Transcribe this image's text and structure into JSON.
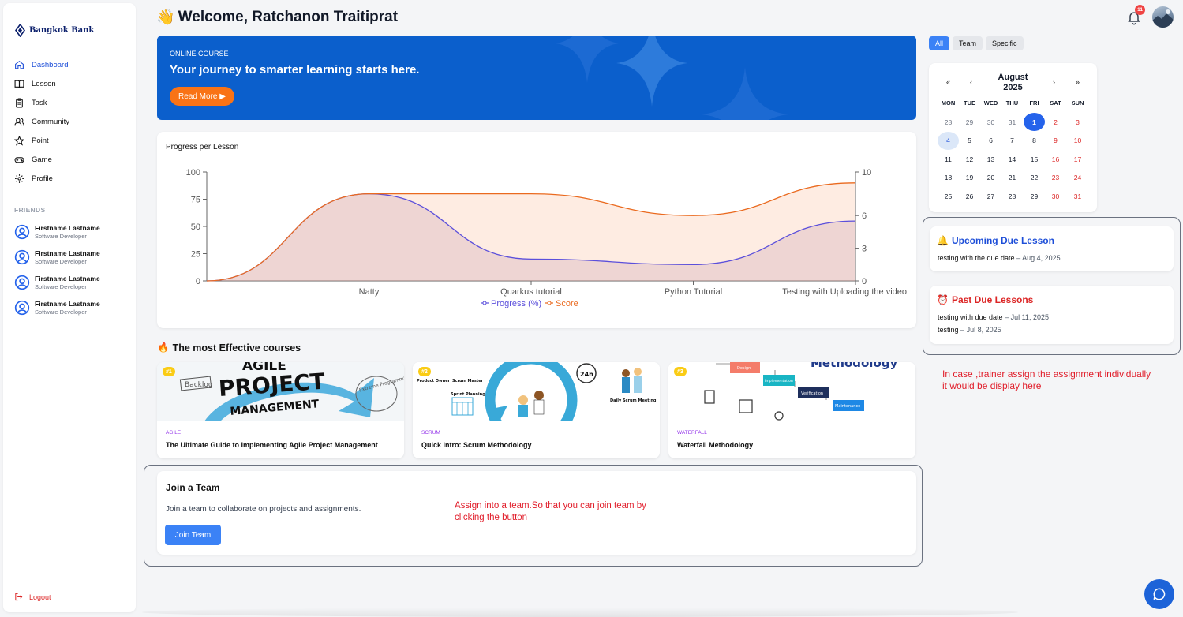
{
  "brand": {
    "name": "Bangkok Bank"
  },
  "sidebar": {
    "items": [
      {
        "label": "Dashboard",
        "icon": "home-icon",
        "active": true
      },
      {
        "label": "Lesson",
        "icon": "book-icon"
      },
      {
        "label": "Task",
        "icon": "clipboard-icon"
      },
      {
        "label": "Community",
        "icon": "users-icon"
      },
      {
        "label": "Point",
        "icon": "star-icon"
      },
      {
        "label": "Game",
        "icon": "gamepad-icon"
      },
      {
        "label": "Profile",
        "icon": "gear-icon"
      }
    ],
    "friends_heading": "FRIENDS",
    "friends": [
      {
        "name": "Firstname Lastname",
        "role": "Software Developer"
      },
      {
        "name": "Firstname Lastname",
        "role": "Software Developer"
      },
      {
        "name": "Firstname Lastname",
        "role": "Software Developer"
      },
      {
        "name": "Firstname Lastname",
        "role": "Software Developer"
      }
    ],
    "logout": "Logout"
  },
  "header": {
    "wave": "👋",
    "welcome": "Welcome, Ratchanon Traitiprat",
    "notification_count": "11"
  },
  "banner": {
    "kicker": "ONLINE COURSE",
    "title": "Your journey to smarter learning starts here.",
    "button": "Read More ▶"
  },
  "progress_card": {
    "title": "Progress per Lesson"
  },
  "chart_data": {
    "type": "area",
    "title": "Progress per Lesson",
    "categories": [
      "",
      "Natty",
      "Quarkus tutorial",
      "Python Tutorial",
      "Testing with Uploading the video"
    ],
    "series": [
      {
        "name": "Progress (%)",
        "axis": "left",
        "color": "#5b4fdb",
        "values": [
          0,
          80,
          20,
          15,
          55
        ]
      },
      {
        "name": "Score",
        "axis": "right",
        "color": "#ea6a1f",
        "values": [
          0,
          8,
          8,
          6,
          9
        ]
      }
    ],
    "y_left": {
      "ticks": [
        0,
        25,
        50,
        75,
        100
      ],
      "range": [
        0,
        100
      ]
    },
    "y_right": {
      "ticks": [
        0,
        3,
        6,
        10
      ],
      "range": [
        0,
        10
      ]
    },
    "legend_position": "bottom-center"
  },
  "courses": {
    "heading_icon": "🔥",
    "heading": "The most Effective courses",
    "items": [
      {
        "rank": "#1",
        "category": "AGILE",
        "title": "The Ultimate Guide to Implementing Agile Project Management",
        "img_text": [
          "AGILE",
          "PROJECT",
          "MANAGEMENT",
          "Backlog",
          "Extreme Programming"
        ]
      },
      {
        "rank": "#2",
        "category": "SCRUM",
        "title": "Quick intro: Scrum Methodology",
        "img_text": [
          "Product Owner",
          "Scrum Master",
          "Sprint Planning",
          "24h",
          "Daily Scrum Meeting"
        ]
      },
      {
        "rank": "#3",
        "category": "WATERFALL",
        "title": "Waterfall Methodology",
        "img_text": [
          "Methodology",
          "Design",
          "Implementation",
          "Verification",
          "Maintenance"
        ]
      }
    ]
  },
  "join_team": {
    "title": "Join a Team",
    "description": "Join a team to collaborate on projects and assignments.",
    "button": "Join Team",
    "note_line1": "Assign into a team.So that you can join team by",
    "note_line2": "clicking the button"
  },
  "filters": {
    "items": [
      "All",
      "Team",
      "Specific"
    ],
    "active": "All"
  },
  "calendar": {
    "month": "August",
    "year": "2025",
    "nav": [
      "«",
      "‹",
      "›",
      "»"
    ],
    "dow": [
      "MON",
      "TUE",
      "WED",
      "THU",
      "FRI",
      "SAT",
      "SUN"
    ],
    "weeks": [
      [
        "28",
        "29",
        "30",
        "31",
        "1",
        "2",
        "3"
      ],
      [
        "4",
        "5",
        "6",
        "7",
        "8",
        "9",
        "10"
      ],
      [
        "11",
        "12",
        "13",
        "14",
        "15",
        "16",
        "17"
      ],
      [
        "18",
        "19",
        "20",
        "21",
        "22",
        "23",
        "24"
      ],
      [
        "25",
        "26",
        "27",
        "28",
        "29",
        "30",
        "31"
      ]
    ],
    "selected": "1",
    "today": "4"
  },
  "upcoming": {
    "icon": "🔔",
    "title": "Upcoming Due Lesson",
    "items": [
      {
        "name": "testing with the due date",
        "date": "Aug 4, 2025"
      }
    ]
  },
  "past_due": {
    "icon": "⏰",
    "title": "Past Due Lessons",
    "items": [
      {
        "name": "testing with due date",
        "date": "Jul 11, 2025"
      },
      {
        "name": "testing",
        "date": "Jul 8, 2025"
      }
    ]
  },
  "right_note": {
    "line1": "In case ,trainer assign the assignment individually",
    "line2": "it would be display here"
  },
  "colors": {
    "primary": "#2563eb",
    "banner": "#0b5fcc",
    "accent_orange": "#f97316",
    "danger": "#dc2626",
    "progress": "#5b4fdb",
    "score": "#ea6a1f"
  }
}
